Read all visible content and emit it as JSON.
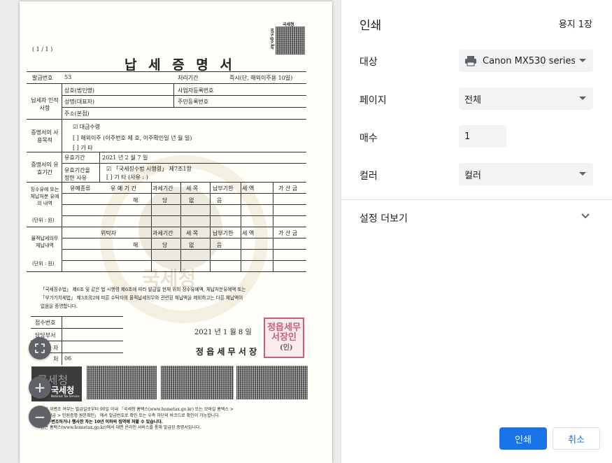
{
  "panel": {
    "title": "인쇄",
    "sheet_count": "용지 1장",
    "destination": {
      "label": "대상",
      "value": "Canon MX530 series F"
    },
    "pages": {
      "label": "페이지",
      "value": "전체"
    },
    "copies": {
      "label": "매수",
      "value": "1"
    },
    "color": {
      "label": "컬러",
      "value": "컬러"
    },
    "more_settings": "설정 더보기",
    "print_button": "인쇄",
    "cancel_button": "취소"
  },
  "document": {
    "page_counter": "( 1 / 1 )",
    "title": "납 세 증 명 서",
    "agency_small": "국세청",
    "site": "nts.go.kr",
    "issue_no_label": "발급번호",
    "issue_no_value": "53",
    "processing_label": "처리기간",
    "processing_value": "즉시(단, 해외이주용 10일)",
    "taxpayer_label": "납세자 인적사항",
    "company_label": "상호(법인명)",
    "bizno_label": "사업자등록번호",
    "name_label": "성명(대표자)",
    "resident_label": "주민등록번호",
    "address_label": "주소(본점)",
    "purpose_label": "증명서의 사용목적",
    "purpose_1": "☑  대금수령",
    "purpose_2": "[  ]  해외이주   (이주번호 제          호, 이주확인일        년    월    일)",
    "purpose_3": "[  ]  기    타",
    "validity_label": "증명서의 유효기간",
    "validity_period_label": "유효기간",
    "validity_date": "2021 년  2 월  7 일",
    "validity_reason_label": "유효기간을 정한 사유",
    "validity_reason_1": "☑  「국세징수법 시행령」 제7조1항",
    "validity_reason_2": "[  ]  기  타  (사유 :                  )",
    "table1_label": "징수유예 또는 체납처분 유예의 내역",
    "table1_unit": "(단위 : 원)",
    "col_type": "유예종류",
    "col_period": "유 예 기 간",
    "col_year": "과세기간",
    "col_item": "세 목",
    "col_due": "납부기한",
    "col_amount": "세 액",
    "col_extra": "가 산 금",
    "none_row": [
      "해",
      "당",
      "없",
      "음"
    ],
    "table2_label": "물적납세의무 체납내역",
    "table2_unit": "(단위 : 원)",
    "col_trustee": "위탁자",
    "certify_text_1": "「국세징수법」 제6조 및 같은 법 시행령 제6조에 따라 발급일 현재 위의 징수유예액, 체납처분유예액 또는",
    "certify_text_2": "「부가가치세법」 제3조의2에 따른 수탁자의 물적납세의무와 관련된 체납액을 제외하고는 다른 체납액이",
    "certify_text_3": "없음을 증명합니다.",
    "receipt_label": "접수번호",
    "dept_label": "담당부서",
    "handler_label": "자",
    "phone_label": "처",
    "phone_value": "06",
    "issue_date": "2021 년  1 월  8 일",
    "office_name": "정 읍 세 무 서 장",
    "seal": "(인)",
    "stamp_text": "정읍세무서장인",
    "logo_text": "국세청",
    "logo_sub": "National Tax Service",
    "footnote_1": "서의 위변조 여부는 발급일로부터 90일 이내 「국세청 홈택스(www.hometax.go.kr) 또는 모바일 홈택스 >",
    "footnote_2": "증명발급 > 민원증명 원본확인」 에서 발급번호로 확인 또는 우측 하단의 바코드로 확인이 가능합니다.",
    "footnote_3": "을 위·변조하거나 행사한 자는 10년 이하의 징역에 처할 수 있습니다.",
    "footnote_4": "명은 홈택스(www.hometax.go.kr)에서 대면 온라인 서비스를 통해 발급된 증명서입니다."
  },
  "zoom": {
    "fit": "fit-to-page-icon",
    "in": "+",
    "out": "−"
  }
}
